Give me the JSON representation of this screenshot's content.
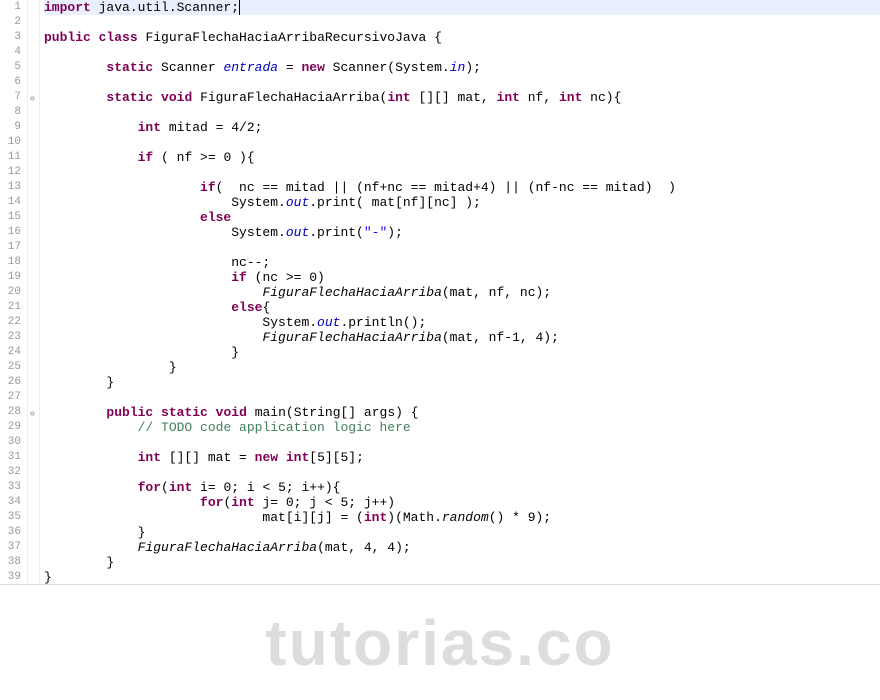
{
  "watermark": "tutorias.co",
  "lines": [
    {
      "n": 1,
      "highlight": true,
      "marker": "",
      "indent": 0,
      "cursor": true,
      "tokens": [
        {
          "t": "kw",
          "v": "import"
        },
        {
          "t": "",
          "v": " java.util.Scanner;"
        }
      ]
    },
    {
      "n": 2,
      "indent": 0,
      "tokens": []
    },
    {
      "n": 3,
      "indent": 0,
      "tokens": [
        {
          "t": "kw",
          "v": "public"
        },
        {
          "t": "",
          "v": " "
        },
        {
          "t": "kw",
          "v": "class"
        },
        {
          "t": "",
          "v": " FiguraFlechaHaciaArribaRecursivoJava {"
        }
      ]
    },
    {
      "n": 4,
      "indent": 0,
      "tokens": []
    },
    {
      "n": 5,
      "indent": 2,
      "tokens": [
        {
          "t": "kw",
          "v": "static"
        },
        {
          "t": "",
          "v": " Scanner "
        },
        {
          "t": "field",
          "v": "entrada"
        },
        {
          "t": "",
          "v": " = "
        },
        {
          "t": "kw",
          "v": "new"
        },
        {
          "t": "",
          "v": " Scanner(System."
        },
        {
          "t": "static-ref",
          "v": "in"
        },
        {
          "t": "",
          "v": ");"
        }
      ]
    },
    {
      "n": 6,
      "indent": 0,
      "tokens": []
    },
    {
      "n": 7,
      "marker": "⊖",
      "indent": 2,
      "tokens": [
        {
          "t": "kw",
          "v": "static"
        },
        {
          "t": "",
          "v": " "
        },
        {
          "t": "kw",
          "v": "void"
        },
        {
          "t": "",
          "v": " FiguraFlechaHaciaArriba("
        },
        {
          "t": "kw",
          "v": "int"
        },
        {
          "t": "",
          "v": " [][] mat, "
        },
        {
          "t": "kw",
          "v": "int"
        },
        {
          "t": "",
          "v": " nf, "
        },
        {
          "t": "kw",
          "v": "int"
        },
        {
          "t": "",
          "v": " nc){"
        }
      ]
    },
    {
      "n": 8,
      "indent": 0,
      "tokens": []
    },
    {
      "n": 9,
      "indent": 3,
      "tokens": [
        {
          "t": "kw",
          "v": "int"
        },
        {
          "t": "",
          "v": " mitad = 4/2;"
        }
      ]
    },
    {
      "n": 10,
      "indent": 0,
      "tokens": []
    },
    {
      "n": 11,
      "indent": 3,
      "tokens": [
        {
          "t": "kw",
          "v": "if"
        },
        {
          "t": "",
          "v": " ( nf >= 0 ){"
        }
      ]
    },
    {
      "n": 12,
      "indent": 0,
      "tokens": []
    },
    {
      "n": 13,
      "indent": 5,
      "tokens": [
        {
          "t": "kw",
          "v": "if"
        },
        {
          "t": "",
          "v": "(  nc == mitad || (nf+nc == mitad+4) || (nf-nc == mitad)  )"
        }
      ]
    },
    {
      "n": 14,
      "indent": 6,
      "tokens": [
        {
          "t": "",
          "v": "System."
        },
        {
          "t": "static-ref",
          "v": "out"
        },
        {
          "t": "",
          "v": ".print( mat[nf][nc] );"
        }
      ]
    },
    {
      "n": 15,
      "indent": 5,
      "tokens": [
        {
          "t": "kw",
          "v": "else"
        }
      ]
    },
    {
      "n": 16,
      "indent": 6,
      "tokens": [
        {
          "t": "",
          "v": "System."
        },
        {
          "t": "static-ref",
          "v": "out"
        },
        {
          "t": "",
          "v": ".print("
        },
        {
          "t": "str",
          "v": "\"-\""
        },
        {
          "t": "",
          "v": ");"
        }
      ]
    },
    {
      "n": 17,
      "indent": 0,
      "tokens": []
    },
    {
      "n": 18,
      "indent": 6,
      "tokens": [
        {
          "t": "",
          "v": "nc--;"
        }
      ]
    },
    {
      "n": 19,
      "indent": 6,
      "tokens": [
        {
          "t": "kw",
          "v": "if"
        },
        {
          "t": "",
          "v": " (nc >= 0)"
        }
      ]
    },
    {
      "n": 20,
      "indent": 7,
      "tokens": [
        {
          "t": "method-static",
          "v": "FiguraFlechaHaciaArriba"
        },
        {
          "t": "",
          "v": "(mat, nf, nc);"
        }
      ]
    },
    {
      "n": 21,
      "indent": 6,
      "tokens": [
        {
          "t": "kw",
          "v": "else"
        },
        {
          "t": "",
          "v": "{"
        }
      ]
    },
    {
      "n": 22,
      "indent": 7,
      "tokens": [
        {
          "t": "",
          "v": "System."
        },
        {
          "t": "static-ref",
          "v": "out"
        },
        {
          "t": "",
          "v": ".println();"
        }
      ]
    },
    {
      "n": 23,
      "indent": 7,
      "tokens": [
        {
          "t": "method-static",
          "v": "FiguraFlechaHaciaArriba"
        },
        {
          "t": "",
          "v": "(mat, nf-1, 4);"
        }
      ]
    },
    {
      "n": 24,
      "indent": 6,
      "tokens": [
        {
          "t": "",
          "v": "}"
        }
      ]
    },
    {
      "n": 25,
      "indent": 4,
      "tokens": [
        {
          "t": "",
          "v": "}"
        }
      ]
    },
    {
      "n": 26,
      "indent": 2,
      "tokens": [
        {
          "t": "",
          "v": "}"
        }
      ]
    },
    {
      "n": 27,
      "indent": 0,
      "tokens": []
    },
    {
      "n": 28,
      "marker": "⊖",
      "indent": 2,
      "tokens": [
        {
          "t": "kw",
          "v": "public"
        },
        {
          "t": "",
          "v": " "
        },
        {
          "t": "kw",
          "v": "static"
        },
        {
          "t": "",
          "v": " "
        },
        {
          "t": "kw",
          "v": "void"
        },
        {
          "t": "",
          "v": " main(String[] args) {"
        }
      ]
    },
    {
      "n": 29,
      "indent": 3,
      "tokens": [
        {
          "t": "cmt",
          "v": "// TODO code application logic here"
        }
      ]
    },
    {
      "n": 30,
      "indent": 0,
      "tokens": []
    },
    {
      "n": 31,
      "indent": 3,
      "tokens": [
        {
          "t": "kw",
          "v": "int"
        },
        {
          "t": "",
          "v": " [][] mat = "
        },
        {
          "t": "kw",
          "v": "new"
        },
        {
          "t": "",
          "v": " "
        },
        {
          "t": "kw",
          "v": "int"
        },
        {
          "t": "",
          "v": "[5][5];"
        }
      ]
    },
    {
      "n": 32,
      "indent": 0,
      "tokens": []
    },
    {
      "n": 33,
      "indent": 3,
      "tokens": [
        {
          "t": "kw",
          "v": "for"
        },
        {
          "t": "",
          "v": "("
        },
        {
          "t": "kw",
          "v": "int"
        },
        {
          "t": "",
          "v": " i= 0; i < 5; i++){"
        }
      ]
    },
    {
      "n": 34,
      "indent": 5,
      "tokens": [
        {
          "t": "kw",
          "v": "for"
        },
        {
          "t": "",
          "v": "("
        },
        {
          "t": "kw",
          "v": "int"
        },
        {
          "t": "",
          "v": " j= 0; j < 5; j++)"
        }
      ]
    },
    {
      "n": 35,
      "indent": 7,
      "tokens": [
        {
          "t": "",
          "v": "mat[i][j] = ("
        },
        {
          "t": "kw",
          "v": "int"
        },
        {
          "t": "",
          "v": ")(Math."
        },
        {
          "t": "method-static",
          "v": "random"
        },
        {
          "t": "",
          "v": "() * 9);"
        }
      ]
    },
    {
      "n": 36,
      "indent": 3,
      "tokens": [
        {
          "t": "",
          "v": "}"
        }
      ]
    },
    {
      "n": 37,
      "indent": 3,
      "tokens": [
        {
          "t": "method-static",
          "v": "FiguraFlechaHaciaArriba"
        },
        {
          "t": "",
          "v": "(mat, 4, 4);"
        }
      ]
    },
    {
      "n": 38,
      "indent": 2,
      "tokens": [
        {
          "t": "",
          "v": "}"
        }
      ]
    },
    {
      "n": 39,
      "indent": 0,
      "tokens": [
        {
          "t": "",
          "v": "}"
        }
      ]
    }
  ]
}
